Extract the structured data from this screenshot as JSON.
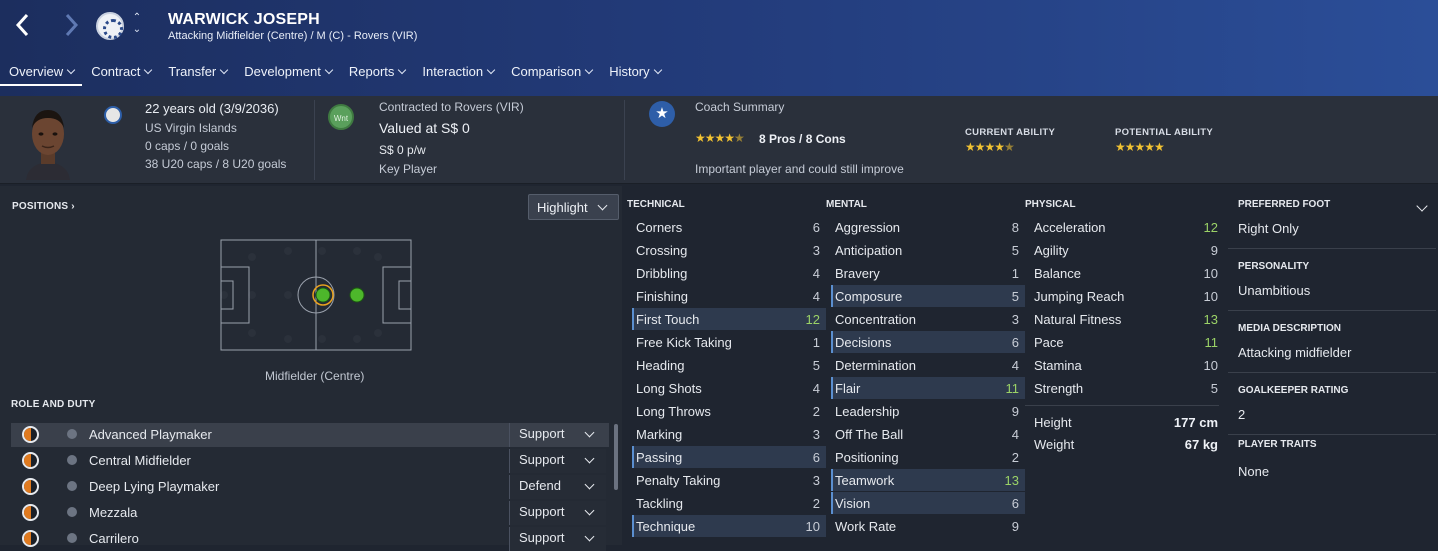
{
  "header": {
    "name": "WARWICK JOSEPH",
    "subtitle": "Attacking Midfielder (Centre) / M (C) - Rovers (VIR)",
    "tabs": [
      "Overview",
      "Contract",
      "Transfer",
      "Development",
      "Reports",
      "Interaction",
      "Comparison",
      "History"
    ]
  },
  "info": {
    "age": "22 years old (3/9/2036)",
    "nationality": "US Virgin Islands",
    "caps": "0 caps / 0 goals",
    "u20caps": "38 U20 caps / 8 U20 goals",
    "contract": "Contracted to Rovers (VIR)",
    "value": "Valued at S$ 0",
    "wage": "S$ 0 p/w",
    "status": "Key Player",
    "wnt": "Wnt",
    "coach_title": "Coach Summary",
    "pros_cons": "8 Pros / 8 Cons",
    "coach_note": "Important player and could still improve",
    "current_ability_label": "CURRENT ABILITY",
    "potential_ability_label": "POTENTIAL ABILITY",
    "coach_stars": 4.5,
    "current_ability_stars": 4.5,
    "potential_ability_stars": 5
  },
  "positions": {
    "title": "POSITIONS",
    "highlight": "Highlight",
    "label": "Midfielder (Centre)"
  },
  "roles": {
    "title": "ROLE AND DUTY",
    "items": [
      {
        "name": "Advanced Playmaker",
        "duty": "Support"
      },
      {
        "name": "Central Midfielder",
        "duty": "Support"
      },
      {
        "name": "Deep Lying Playmaker",
        "duty": "Defend"
      },
      {
        "name": "Mezzala",
        "duty": "Support"
      },
      {
        "name": "Carrilero",
        "duty": "Support"
      }
    ]
  },
  "technical": {
    "title": "TECHNICAL",
    "items": [
      {
        "name": "Corners",
        "value": "6"
      },
      {
        "name": "Crossing",
        "value": "3"
      },
      {
        "name": "Dribbling",
        "value": "4"
      },
      {
        "name": "Finishing",
        "value": "4"
      },
      {
        "name": "First Touch",
        "value": "12"
      },
      {
        "name": "Free Kick Taking",
        "value": "1"
      },
      {
        "name": "Heading",
        "value": "5"
      },
      {
        "name": "Long Shots",
        "value": "4"
      },
      {
        "name": "Long Throws",
        "value": "2"
      },
      {
        "name": "Marking",
        "value": "3"
      },
      {
        "name": "Passing",
        "value": "6"
      },
      {
        "name": "Penalty Taking",
        "value": "3"
      },
      {
        "name": "Tackling",
        "value": "2"
      },
      {
        "name": "Technique",
        "value": "10"
      }
    ]
  },
  "mental": {
    "title": "MENTAL",
    "items": [
      {
        "name": "Aggression",
        "value": "8"
      },
      {
        "name": "Anticipation",
        "value": "5"
      },
      {
        "name": "Bravery",
        "value": "1"
      },
      {
        "name": "Composure",
        "value": "5"
      },
      {
        "name": "Concentration",
        "value": "3"
      },
      {
        "name": "Decisions",
        "value": "6"
      },
      {
        "name": "Determination",
        "value": "4"
      },
      {
        "name": "Flair",
        "value": "11"
      },
      {
        "name": "Leadership",
        "value": "9"
      },
      {
        "name": "Off The Ball",
        "value": "4"
      },
      {
        "name": "Positioning",
        "value": "2"
      },
      {
        "name": "Teamwork",
        "value": "13"
      },
      {
        "name": "Vision",
        "value": "6"
      },
      {
        "name": "Work Rate",
        "value": "9"
      }
    ]
  },
  "physical": {
    "title": "PHYSICAL",
    "items": [
      {
        "name": "Acceleration",
        "value": "12"
      },
      {
        "name": "Agility",
        "value": "9"
      },
      {
        "name": "Balance",
        "value": "10"
      },
      {
        "name": "Jumping Reach",
        "value": "10"
      },
      {
        "name": "Natural Fitness",
        "value": "13"
      },
      {
        "name": "Pace",
        "value": "11"
      },
      {
        "name": "Stamina",
        "value": "10"
      },
      {
        "name": "Strength",
        "value": "5"
      }
    ],
    "height_label": "Height",
    "height": "177 cm",
    "weight_label": "Weight",
    "weight": "67 kg"
  },
  "side": {
    "foot_label": "PREFERRED FOOT",
    "foot": "Right Only",
    "personality_label": "PERSONALITY",
    "personality": "Unambitious",
    "media_label": "MEDIA DESCRIPTION",
    "media": "Attacking midfielder",
    "gk_label": "GOALKEEPER RATING",
    "gk": "2",
    "traits_label": "PLAYER TRAITS",
    "traits": "None"
  },
  "colors": {
    "accent": "#2b4e98",
    "highlight_green": "#9bd267",
    "star": "#f1c232"
  }
}
